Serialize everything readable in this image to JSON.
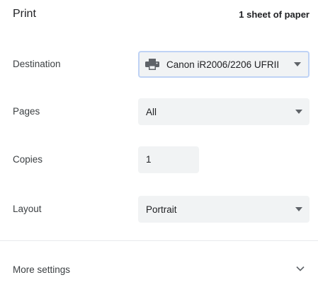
{
  "header": {
    "title": "Print",
    "sheet_count": "1 sheet of paper"
  },
  "destination": {
    "label": "Destination",
    "value": "Canon iR2006/2206 UFRII",
    "icon": "printer-icon"
  },
  "pages": {
    "label": "Pages",
    "value": "All"
  },
  "copies": {
    "label": "Copies",
    "value": "1"
  },
  "layout": {
    "label": "Layout",
    "value": "Portrait"
  },
  "more_settings": {
    "label": "More settings",
    "icon": "chevron-down-icon"
  },
  "colors": {
    "control_bg": "#f1f3f4",
    "focus_border": "#bfd3f5",
    "icon": "#5f6368"
  }
}
